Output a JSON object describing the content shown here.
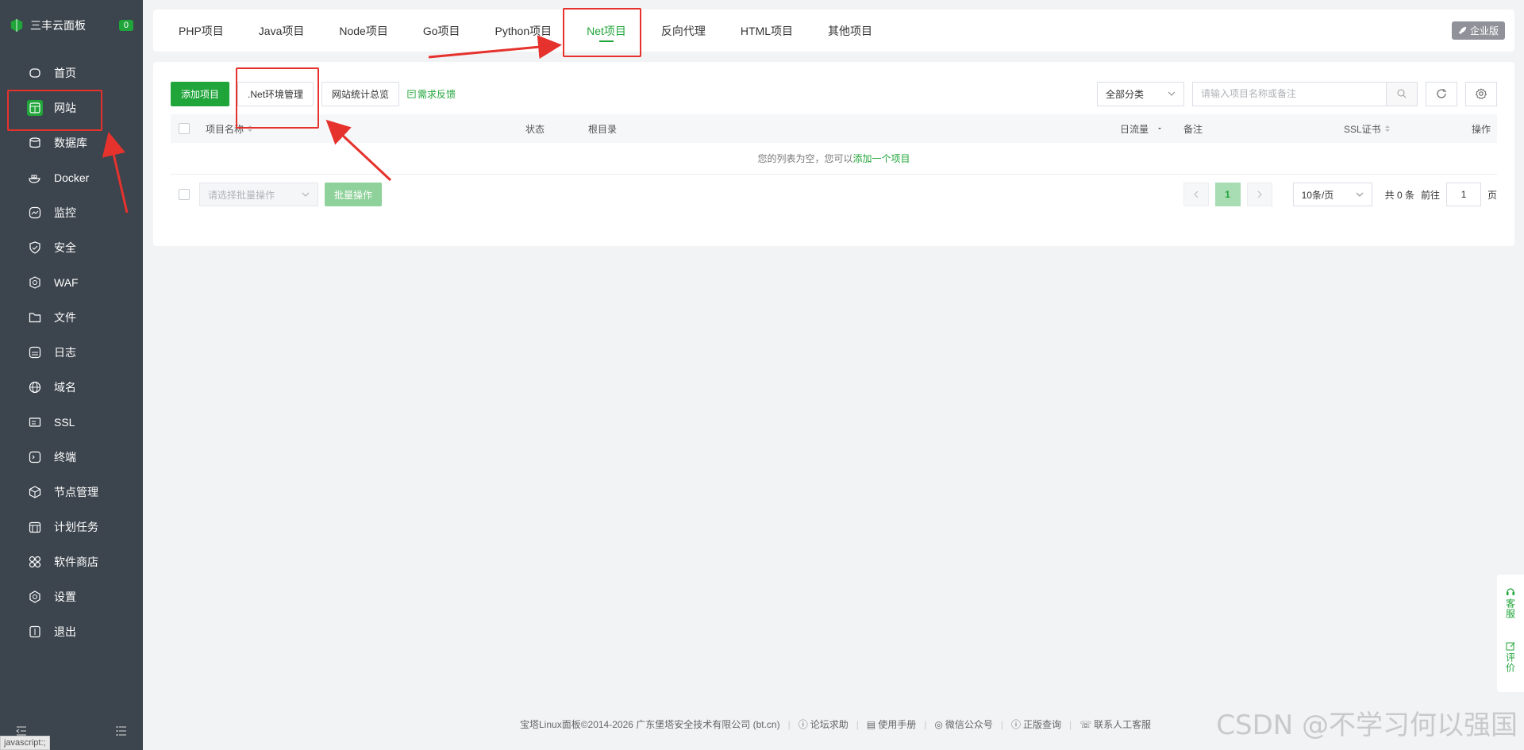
{
  "sidebar": {
    "brand_title": "三丰云面板",
    "brand_badge": "0",
    "items": [
      {
        "label": "首页",
        "icon": "home-icon"
      },
      {
        "label": "网站",
        "icon": "globe-icon",
        "active": true
      },
      {
        "label": "数据库",
        "icon": "database-icon"
      },
      {
        "label": "Docker",
        "icon": "docker-icon"
      },
      {
        "label": "监控",
        "icon": "monitor-icon"
      },
      {
        "label": "安全",
        "icon": "shield-icon"
      },
      {
        "label": "WAF",
        "icon": "waf-icon"
      },
      {
        "label": "文件",
        "icon": "folder-icon"
      },
      {
        "label": "日志",
        "icon": "log-icon"
      },
      {
        "label": "域名",
        "icon": "domain-icon"
      },
      {
        "label": "SSL",
        "icon": "ssl-icon"
      },
      {
        "label": "终端",
        "icon": "terminal-icon"
      },
      {
        "label": "节点管理",
        "icon": "node-icon"
      },
      {
        "label": "计划任务",
        "icon": "calendar-icon"
      },
      {
        "label": "软件商店",
        "icon": "store-icon"
      },
      {
        "label": "设置",
        "icon": "gear-icon"
      },
      {
        "label": "退出",
        "icon": "logout-icon"
      }
    ],
    "status_tip": "javascript:;"
  },
  "tabs": {
    "items": [
      "PHP项目",
      "Java项目",
      "Node项目",
      "Go项目",
      "Python项目",
      "Net项目",
      "反向代理",
      "HTML项目",
      "其他项目"
    ],
    "active_index": 5,
    "enterprise_badge": "企业版"
  },
  "toolbar": {
    "add_project": "添加项目",
    "net_env": ".Net环境管理",
    "site_stats": "网站统计总览",
    "feedback": "需求反馈",
    "category_select": "全部分类",
    "search_placeholder": "请输入项目名称或备注"
  },
  "table": {
    "headers": {
      "name": "项目名称",
      "status": "状态",
      "root": "根目录",
      "traffic": "日流量",
      "remark": "备注",
      "ssl": "SSL证书",
      "action": "操作"
    },
    "empty_prefix": "您的列表为空，您可以",
    "empty_link": "添加一个项目"
  },
  "batch": {
    "placeholder": "请选择批量操作",
    "button": "批量操作"
  },
  "pagination": {
    "current": "1",
    "page_size": "10条/页",
    "total": "共 0 条",
    "goto_prefix": "前往",
    "goto_value": "1",
    "goto_suffix": "页"
  },
  "footer": {
    "copyright": "宝塔Linux面板©2014-2026 广东堡塔安全技术有限公司 (bt.cn)",
    "links": [
      "论坛求助",
      "使用手册",
      "微信公众号",
      "正版查询",
      "联系人工客服"
    ]
  },
  "float_right": {
    "service": "客服",
    "review": "评价"
  },
  "watermark": "CSDN @不学习何以强国",
  "colors": {
    "accent": "#20a53a",
    "sidebar_bg": "#3c444d",
    "annotation": "#e5322d"
  }
}
